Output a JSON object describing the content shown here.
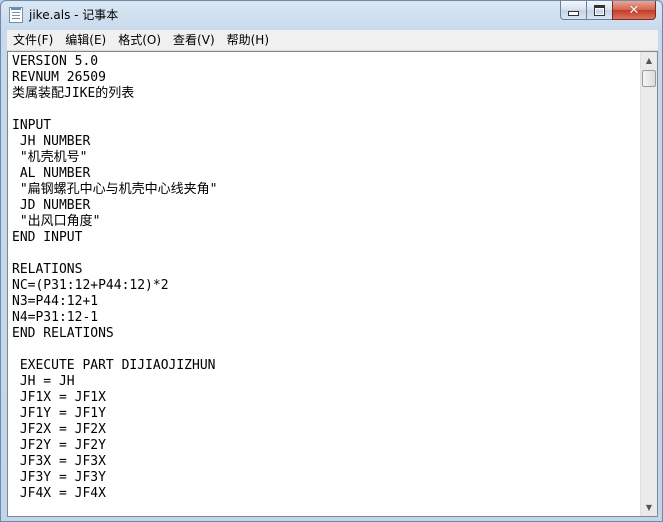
{
  "window": {
    "title": "jike.als - 记事本"
  },
  "caption_buttons": {
    "close_glyph": "✕"
  },
  "menu": {
    "items": [
      "文件(F)",
      "编辑(E)",
      "格式(O)",
      "查看(V)",
      "帮助(H)"
    ]
  },
  "editor": {
    "lines": [
      "VERSION 5.0",
      "REVNUM 26509",
      "类属装配JIKE的列表",
      "",
      "INPUT",
      " JH NUMBER",
      " \"机壳机号\"",
      " AL NUMBER",
      " \"扁钢螺孔中心与机壳中心线夹角\"",
      " JD NUMBER",
      " \"出风口角度\"",
      "END INPUT",
      "",
      "RELATIONS",
      "NC=(P31:12+P44:12)*2",
      "N3=P44:12+1",
      "N4=P31:12-1",
      "END RELATIONS",
      "",
      " EXECUTE PART DIJIAOJIZHUN",
      " JH = JH",
      " JF1X = JF1X",
      " JF1Y = JF1Y",
      " JF2X = JF2X",
      " JF2Y = JF2Y",
      " JF3X = JF3X",
      " JF3Y = JF3Y",
      " JF4X = JF4X"
    ]
  },
  "scrollbar": {
    "up_arrow": "▲",
    "down_arrow": "▼"
  }
}
